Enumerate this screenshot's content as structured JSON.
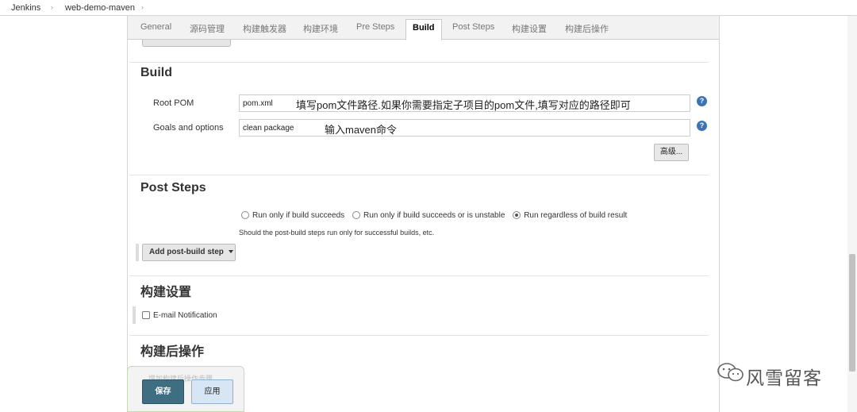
{
  "breadcrumb": {
    "items": [
      "Jenkins",
      "web-demo-maven"
    ],
    "separator": "›"
  },
  "tabs": [
    {
      "label": "General",
      "active": false
    },
    {
      "label": "源码管理",
      "active": false
    },
    {
      "label": "构建触发器",
      "active": false
    },
    {
      "label": "构建环境",
      "active": false
    },
    {
      "label": "Pre Steps",
      "active": false
    },
    {
      "label": "Build",
      "active": true
    },
    {
      "label": "Post Steps",
      "active": false
    },
    {
      "label": "构建设置",
      "active": false
    },
    {
      "label": "构建后操作",
      "active": false
    }
  ],
  "build": {
    "title": "Build",
    "root_pom": {
      "label": "Root POM",
      "value": "pom.xml",
      "annotation": "填写pom文件路径.如果你需要指定子项目的pom文件,填写对应的路径即可"
    },
    "goals": {
      "label": "Goals and options",
      "value": "clean package",
      "annotation": "输入maven命令"
    },
    "help_glyph": "?",
    "advanced_label": "高级..."
  },
  "post_steps": {
    "title": "Post Steps",
    "options": [
      {
        "label": "Run only if build succeeds",
        "selected": false
      },
      {
        "label": "Run only if build succeeds or is unstable",
        "selected": false
      },
      {
        "label": "Run regardless of build result",
        "selected": true
      }
    ],
    "hint": "Should the post-build steps run only for successful builds, etc.",
    "add_button": "Add post-build step"
  },
  "build_settings": {
    "title": "构建设置",
    "email_label": "E-mail Notification",
    "email_checked": false
  },
  "post_build": {
    "title": "构建后操作",
    "add_button_faded": "增加构建后操作步骤"
  },
  "footer": {
    "save_label": "保存",
    "apply_label": "应用"
  },
  "watermark": {
    "text": "风雪留客",
    "icon": "wechat-icon"
  },
  "colors": {
    "save_bg": "#3f6e82",
    "apply_bg": "#d6e6f5",
    "help_icon": "#3b73b9"
  }
}
